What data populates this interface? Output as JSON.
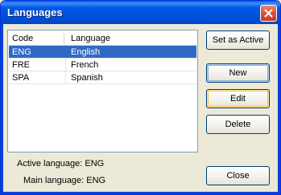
{
  "window": {
    "title": "Languages"
  },
  "list": {
    "columns": [
      "Code",
      "Language"
    ],
    "rows": [
      {
        "code": "ENG",
        "language": "English",
        "selected": true
      },
      {
        "code": "FRE",
        "language": "French",
        "selected": false
      },
      {
        "code": "SPA",
        "language": "Spanish",
        "selected": false
      }
    ]
  },
  "buttons": {
    "set_active": "Set as Active",
    "new": "New",
    "edit": "Edit",
    "delete": "Delete",
    "close": "Close"
  },
  "status": {
    "active_label": "Active language: ENG",
    "main_label": "Main language: ENG"
  },
  "colors": {
    "titlebar": "#0058e6",
    "selection": "#316ac5",
    "dialog_bg": "#ece9d8"
  }
}
